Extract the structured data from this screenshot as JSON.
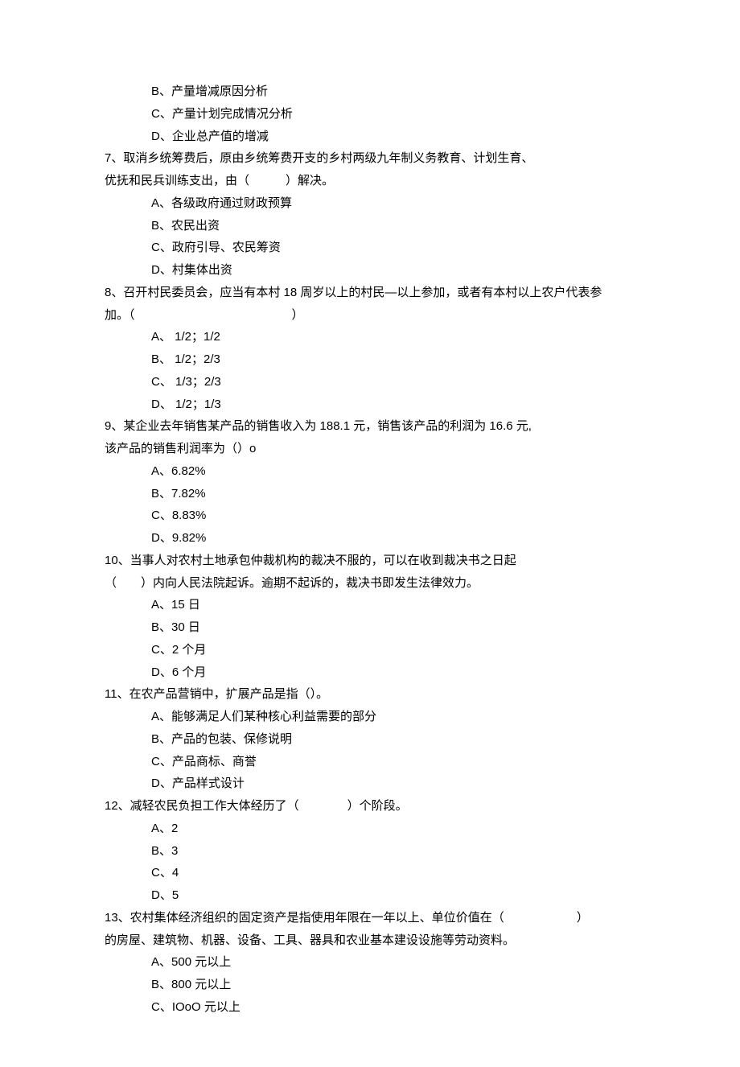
{
  "leading_options": {
    "b": "B、产量增减原因分析",
    "c": "C、产量计划完成情况分析",
    "d": "D、企业总产值的增减"
  },
  "q7": {
    "stem1": "7、取消乡统筹费后，原由乡统筹费开支的乡村两级九年制义务教育、计划生育、",
    "stem2": "优抚和民兵训练支出，由（　　　）解决。",
    "a": "A、各级政府通过财政预算",
    "b": "B、农民出资",
    "c": "C、政府引导、农民筹资",
    "d": "D、村集体出资"
  },
  "q8": {
    "stem1": "8、召开村民委员会，应当有本村 18 周岁以上的村民—以上参加，或者有本村以上农户代表参",
    "stem2": "加。（　　　　　　　　　　　　　）",
    "a": "A、 1/2；1/2",
    "b": "B、 1/2；2/3",
    "c": "C、 1/3；2/3",
    "d": "D、 1/2；1/3"
  },
  "q9": {
    "stem1": "9、某企业去年销售某产品的销售收入为 188.1 元，销售该产品的利润为 16.6 元,",
    "stem2": "该产品的销售利润率为（）o",
    "a": "A、6.82%",
    "b": "B、7.82%",
    "c": "C、8.83%",
    "d": "D、9.82%"
  },
  "q10": {
    "stem1": "10、当事人对农村土地承包仲裁机构的裁决不服的，可以在收到裁决书之日起",
    "stem2": "（　　）内向人民法院起诉。逾期不起诉的，裁决书即发生法律效力。",
    "a": "A、15 日",
    "b": "B、30 日",
    "c": "C、2 个月",
    "d": "D、6 个月"
  },
  "q11": {
    "stem": "11、在农产品营销中，扩展产品是指（）。",
    "a": "A、能够满足人们某种核心利益需要的部分",
    "b": "B、产品的包装、保修说明",
    "c": "C、产品商标、商誉",
    "d": "D、产品样式设计"
  },
  "q12": {
    "stem": "12、减轻农民负担工作大体经历了（　　　　）个阶段。",
    "a": "A、2",
    "b": "B、3",
    "c": "C、4",
    "d": "D、5"
  },
  "q13": {
    "stem1": "13、农村集体经济组织的固定资产是指使用年限在一年以上、单位价值在（　　　　　　）",
    "stem2": "的房屋、建筑物、机器、设备、工具、器具和农业基本建设设施等劳动资料。",
    "a": "A、500 元以上",
    "b": "B、800 元以上",
    "c": "C、IOoO 元以上"
  }
}
